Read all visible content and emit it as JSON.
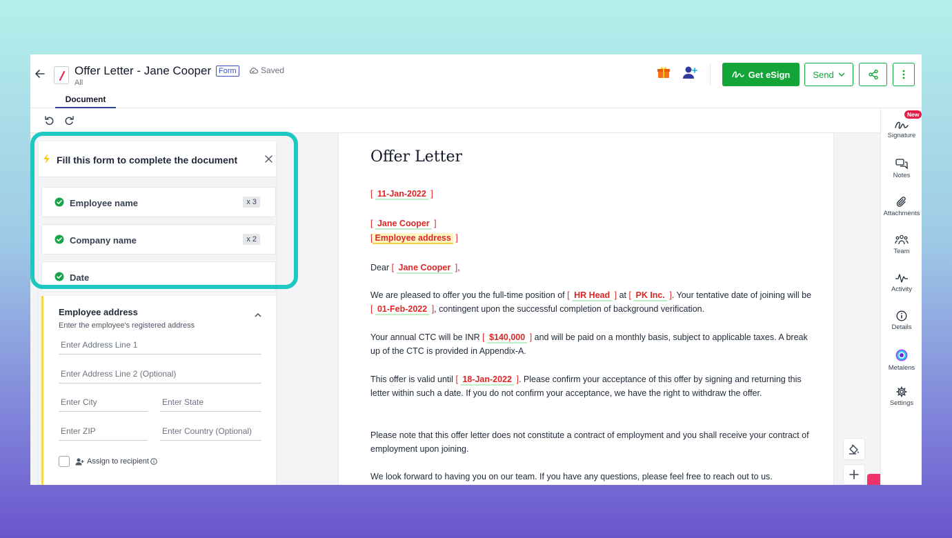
{
  "header": {
    "title": "Offer Letter - Jane Cooper",
    "form_badge": "Form",
    "saved_label": "Saved",
    "subtitle": "All",
    "tab_document": "Document",
    "esign_label": "Get eSign",
    "send_label": "Send"
  },
  "form_panel": {
    "title": "Fill this form to complete the document",
    "fields": [
      {
        "label": "Employee name",
        "count": "x 3"
      },
      {
        "label": "Company name",
        "count": "x 2"
      },
      {
        "label": "Date",
        "count": ""
      }
    ],
    "address": {
      "title": "Employee address",
      "description": "Enter the employee's registered address",
      "line1_placeholder": "Enter Address Line 1",
      "line2_placeholder": "Enter Address Line 2 (Optional)",
      "city_placeholder": "Enter City",
      "state_placeholder": "Enter State",
      "zip_placeholder": "Enter ZIP",
      "country_placeholder": "Enter Country (Optional)",
      "assign_label": "Assign to recipient"
    }
  },
  "document": {
    "heading": "Offer Letter",
    "date": "11-Jan-2022",
    "employee_name": "Jane Cooper",
    "employee_address": "Employee address",
    "dear": "Dear",
    "p1_a": "We are pleased to offer you the full-time position of",
    "position": "HR Head",
    "p1_b": "at",
    "company": "PK Inc.",
    "p1_c": ". Your tentative date of joining will be",
    "join_date": "01-Feb-2022",
    "p1_d": ", contingent upon the successful completion of background verification.",
    "p2_a": "Your annual CTC will be INR",
    "ctc": "$140,000",
    "p2_b": "and will be paid on a monthly basis, subject to applicable taxes. A break up of the CTC is provided in Appendix-A.",
    "p3_a": "This offer is valid until",
    "valid_until": "18-Jan-2022",
    "p3_b": ". Please confirm your acceptance of this offer by signing and returning this letter within such a date. If you do not confirm your acceptance, we have the right to withdraw the offer.",
    "p4": "Please note that this offer letter does not constitute a contract of employment and you shall receive your contract of employment upon joining.",
    "p5": "We look forward to having you on our team. If you have any questions, please feel free to reach out to us."
  },
  "rail": {
    "new_badge": "New",
    "items": [
      "Signature",
      "Notes",
      "Attachments",
      "Team",
      "Activity",
      "Details",
      "Metalens",
      "Settings"
    ]
  },
  "colors": {
    "accent_green": "#13a538",
    "highlight_teal": "#1ec8c0",
    "field_red": "#dc2626",
    "new_badge": "#e11d48"
  }
}
